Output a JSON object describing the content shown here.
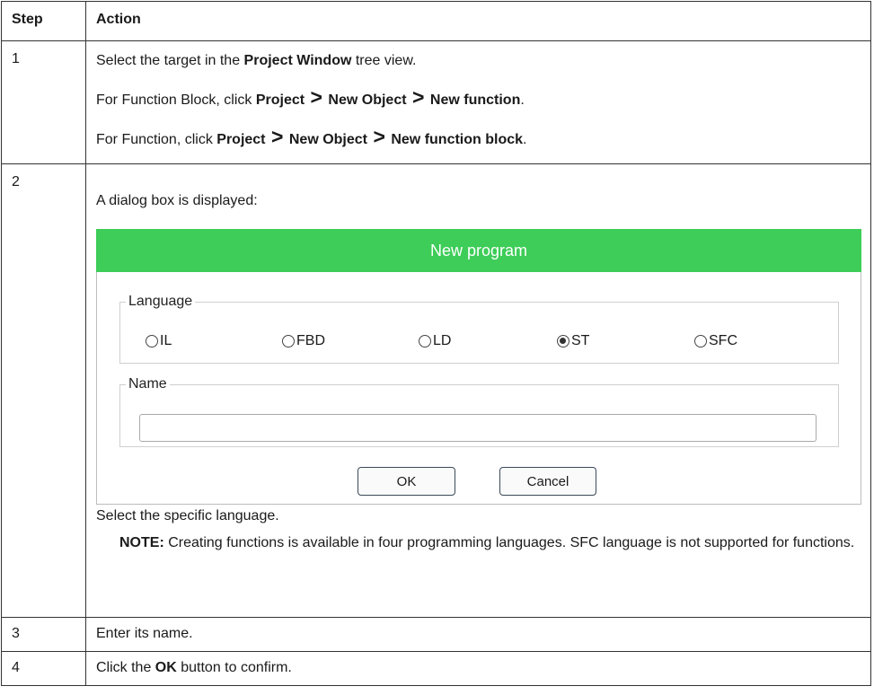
{
  "header": {
    "step": "Step",
    "action": "Action"
  },
  "rows": [
    {
      "step": "1",
      "line1": {
        "pre": "Select the target in the ",
        "bold": "Project Window",
        "post": " tree view."
      },
      "line2": {
        "pre": "For Function Block, click ",
        "p1": "Project",
        "p2": "New Object",
        "p3": "New function",
        "post": "."
      },
      "line3": {
        "pre": "For Function, click ",
        "p1": "Project",
        "p2": "New Object",
        "p3": "New function block",
        "post": "."
      }
    },
    {
      "step": "2",
      "intro": "A dialog box is displayed:",
      "after": "Select the specific language.",
      "note_label": "NOTE:",
      "note_text": " Creating functions is available in four programming languages. SFC language is not supported for functions."
    },
    {
      "step": "3",
      "text": "Enter its name."
    },
    {
      "step": "4",
      "pre": "Click the ",
      "bold": "OK",
      "post": " button to confirm."
    }
  ],
  "separator": ">",
  "dialog": {
    "title": "New program",
    "title_color": "#3dcd58",
    "language_legend": "Language",
    "languages": [
      {
        "label": "IL",
        "selected": false
      },
      {
        "label": "FBD",
        "selected": false
      },
      {
        "label": "LD",
        "selected": false
      },
      {
        "label": "ST",
        "selected": true
      },
      {
        "label": "SFC",
        "selected": false
      }
    ],
    "name_legend": "Name",
    "name_value": "",
    "ok_label": "OK",
    "cancel_label": "Cancel"
  }
}
